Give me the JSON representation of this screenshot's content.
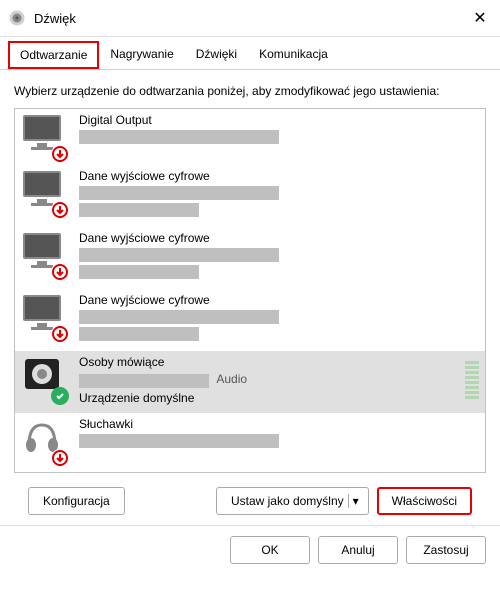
{
  "window": {
    "title": "Dźwięk"
  },
  "tabs": [
    {
      "label": "Odtwarzanie",
      "active": true
    },
    {
      "label": "Nagrywanie"
    },
    {
      "label": "Dźwięki"
    },
    {
      "label": "Komunikacja"
    }
  ],
  "instruction": "Wybierz urządzenie do odtwarzania poniżej, aby zmodyfikować jego ustawienia:",
  "devices": [
    {
      "name": "Digital Output",
      "icon": "monitor",
      "status": "unplugged",
      "selected": false
    },
    {
      "name": "Dane wyjściowe cyfrowe",
      "icon": "monitor",
      "status": "unplugged",
      "selected": false
    },
    {
      "name": "Dane wyjściowe cyfrowe",
      "icon": "monitor",
      "status": "unplugged",
      "selected": false
    },
    {
      "name": "Dane wyjściowe cyfrowe",
      "icon": "monitor",
      "status": "unplugged",
      "selected": false
    },
    {
      "name": "Osoby mówiące",
      "icon": "speaker",
      "status": "default",
      "status_text": "Urządzenie domyślne",
      "audio_label": "Audio",
      "selected": true
    },
    {
      "name": "Słuchawki",
      "icon": "headphones",
      "status": "unplugged",
      "selected": false
    }
  ],
  "buttons": {
    "configure": "Konfiguracja",
    "set_default": "Ustaw jako domyślny",
    "properties": "Właściwości",
    "ok": "OK",
    "cancel": "Anuluj",
    "apply": "Zastosuj"
  }
}
